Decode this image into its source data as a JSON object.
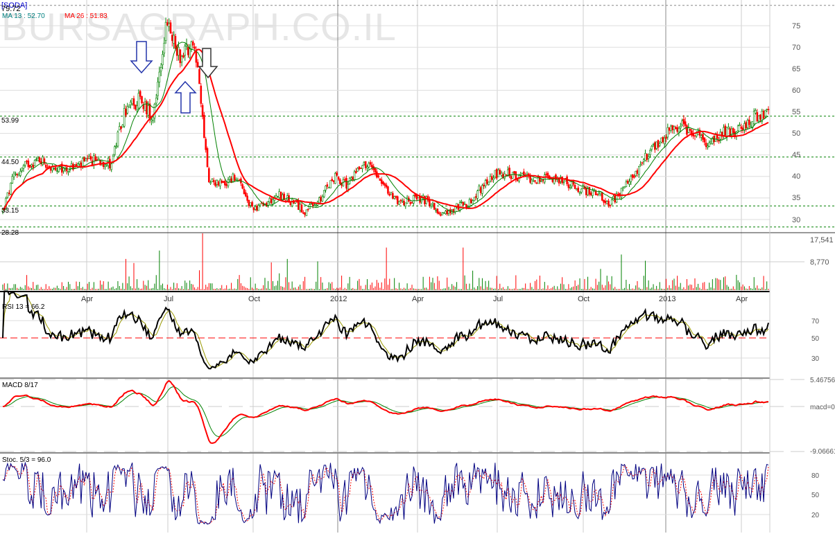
{
  "header": {
    "symbol": "[SODA]",
    "last_high": "79.72",
    "ma13_label": "MA 13 : 52.70",
    "ma26_label": "MA 26 : 51.83",
    "watermark": "BURSAGRAPH.CO.IL"
  },
  "colors": {
    "up": "#008000",
    "down": "#ff0000",
    "ma13": "#008000",
    "ma26": "#ff0000",
    "rsi": "#000000",
    "rsi_signal": "#999900",
    "macd": "#ff0000",
    "macd_signal": "#008000",
    "stoch_k": "#000080",
    "stoch_d": "#ff0000",
    "level": "#008000"
  },
  "chart_data": [
    {
      "type": "candlestick",
      "title": "[SODA]",
      "x_tick_labels": [
        "Apr",
        "Jul",
        "Oct",
        "2012",
        "Apr",
        "Jul",
        "Oct",
        "2013",
        "Apr"
      ],
      "y_ticks": [
        "75",
        "70",
        "65",
        "60",
        "55",
        "50",
        "45",
        "40",
        "35",
        "30"
      ],
      "ylim": [
        28,
        80
      ],
      "levels": [
        "79.72",
        "53.99",
        "44.50",
        "33.15",
        "28.28"
      ],
      "approx_close_halfmonthly": [
        30,
        40,
        43,
        44,
        41,
        42,
        43,
        44,
        43,
        55,
        58,
        54,
        75,
        68,
        72,
        40,
        38,
        40,
        33,
        33,
        36,
        34,
        32,
        34,
        40,
        38,
        43,
        42,
        36,
        34,
        35,
        34,
        31,
        33,
        34,
        39,
        41,
        40,
        40,
        39,
        40,
        38,
        37,
        36,
        34,
        37,
        42,
        46,
        50,
        52,
        50,
        48,
        50,
        50,
        53,
        55
      ],
      "series": [
        {
          "name": "MA 13",
          "last": 52.7
        },
        {
          "name": "MA 26",
          "last": 51.83
        }
      ]
    },
    {
      "type": "bar",
      "title": "Volume",
      "y_ticks": [
        "17,541",
        "8,770"
      ],
      "ylim": [
        0,
        17541
      ]
    },
    {
      "type": "line",
      "title": "RSI 13 = 66.2",
      "y_ticks": [
        "70",
        "50",
        "30"
      ],
      "ylim": [
        20,
        85
      ],
      "last": 66.2
    },
    {
      "type": "line",
      "title": "MACD 8/17",
      "y_ticks": [
        "5.46756",
        "macd=0",
        "-9.06661"
      ],
      "ylim": [
        -9.06661,
        5.46756
      ]
    },
    {
      "type": "line",
      "title": "Stoc. 5/3 = 96.0",
      "y_ticks": [
        "80",
        "50",
        "20"
      ],
      "ylim": [
        0,
        100
      ],
      "last": 96.0
    }
  ]
}
